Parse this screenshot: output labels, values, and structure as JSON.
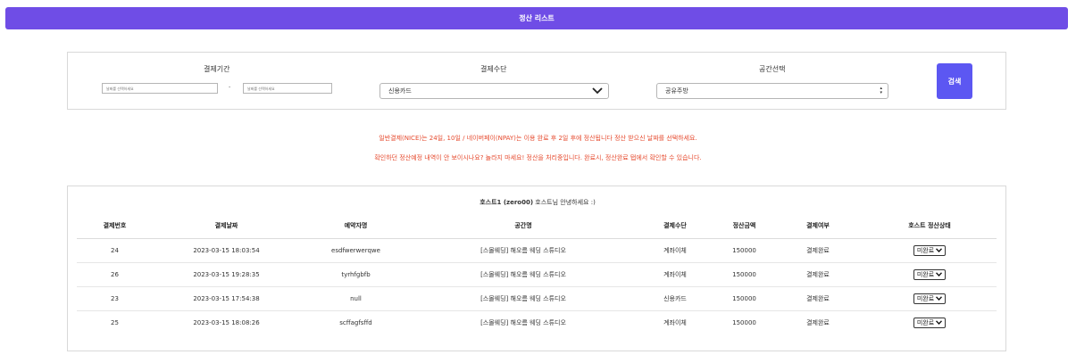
{
  "header": {
    "title": "정산 리스트"
  },
  "filter": {
    "period_label": "결제기간",
    "start_placeholder": "날짜를 선택하세요",
    "end_placeholder": "날짜를 선택하세요",
    "separator": "-",
    "method_label": "결제수단",
    "method_value": "신용카드",
    "space_label": "공간선택",
    "space_value": "공유주방",
    "search_label": "검색"
  },
  "notice": {
    "line1": "일반결제(NICE)는 24일, 10일 / 네이버페이(NPAY)는 이용 완료 후 2일 후에 정산됩니다 정산 받으신 날짜를 선택하세요.",
    "line2": "확인하던 정산예정 내역이 안 보이시나요? 놀라지 마세요! 정산을 처리중입니다. 완료시, 정산완료 탭에서 확인할 수 있습니다."
  },
  "greeting": {
    "host": "호스트1 (zero00)",
    "suffix": "호스트님 안녕하세요 :)"
  },
  "table": {
    "columns": [
      "결제번호",
      "결제날짜",
      "예약자명",
      "공간명",
      "결제수단",
      "정산금액",
      "결제여부",
      "호스트 정산상태"
    ],
    "rows": [
      {
        "no": "24",
        "date": "2023-03-15 18:03:54",
        "name": "esdfwerwerqwe",
        "space": "[스몰웨딩] 해오름 웨딩 스튜디오",
        "method": "계좌이체",
        "amount": "150000",
        "paid": "결제완료",
        "state": "미완료"
      },
      {
        "no": "26",
        "date": "2023-03-15 19:28:35",
        "name": "tyrhfgbfb",
        "space": "[스몰웨딩] 해오름 웨딩 스튜디오",
        "method": "계좌이체",
        "amount": "150000",
        "paid": "결제완료",
        "state": "미완료"
      },
      {
        "no": "23",
        "date": "2023-03-15 17:54:38",
        "name": "null",
        "space": "[스몰웨딩] 해오름 웨딩 스튜디오",
        "method": "신용카드",
        "amount": "150000",
        "paid": "결제완료",
        "state": "미완료"
      },
      {
        "no": "25",
        "date": "2023-03-15 18:08:26",
        "name": "scffagfsffd",
        "space": "[스몰웨딩] 해오름 웨딩 스튜디오",
        "method": "계좌이체",
        "amount": "150000",
        "paid": "결제완료",
        "state": "미완료"
      }
    ]
  },
  "colors": {
    "topbar": "#6f4de6",
    "search_button": "#5c57f2",
    "notice": "#e64a2e"
  }
}
